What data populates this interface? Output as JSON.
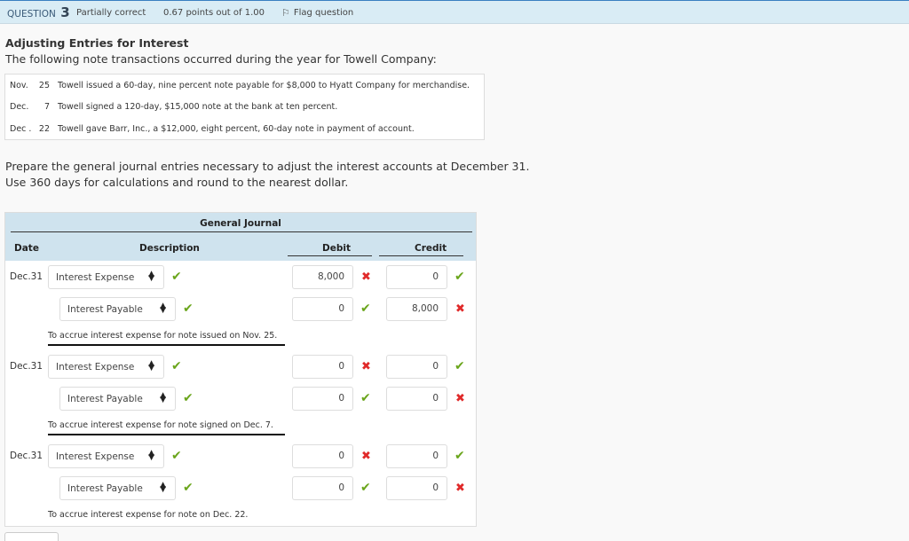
{
  "question_bar": {
    "label": "QUESTION",
    "number": "3",
    "status": "Partially correct",
    "points": "0.67 points out of 1.00",
    "flag_icon": "flag-icon",
    "flag_label": "Flag question"
  },
  "problem": {
    "title": "Adjusting Entries for Interest",
    "intro": "The following note transactions occurred during the year for Towell Company:",
    "notes": [
      {
        "month": "Nov.",
        "day": "25",
        "text": "Towell issued a 60-day, nine percent note payable for $8,000 to Hyatt Company for merchandise."
      },
      {
        "month": "Dec.",
        "day": "7",
        "text": "Towell signed a 120-day, $15,000 note at the bank at ten percent."
      },
      {
        "month": "Dec .",
        "day": "22",
        "text": "Towell gave Barr, Inc., a $12,000, eight percent, 60-day note in payment of account."
      }
    ],
    "prompt_line1": "Prepare the general journal entries necessary to adjust the interest accounts at December 31.",
    "prompt_line2": "Use 360 days for calculations and round to the nearest dollar."
  },
  "journal": {
    "title": "General Journal",
    "columns": {
      "date": "Date",
      "description": "Description",
      "debit": "Debit",
      "credit": "Credit"
    },
    "entries": [
      {
        "date": "Dec.31",
        "lines": [
          {
            "account": "Interest Expense",
            "account_mark": "correct",
            "debit": "8,000",
            "debit_mark": "incorrect",
            "credit": "0",
            "credit_mark": "correct"
          },
          {
            "account": "Interest Payable",
            "account_mark": "correct",
            "debit": "0",
            "debit_mark": "correct",
            "credit": "8,000",
            "credit_mark": "incorrect"
          }
        ],
        "memo": "To accrue interest expense for note issued on Nov. 25."
      },
      {
        "date": "Dec.31",
        "lines": [
          {
            "account": "Interest Expense",
            "account_mark": "correct",
            "debit": "0",
            "debit_mark": "incorrect",
            "credit": "0",
            "credit_mark": "correct"
          },
          {
            "account": "Interest Payable",
            "account_mark": "correct",
            "debit": "0",
            "debit_mark": "correct",
            "credit": "0",
            "credit_mark": "incorrect"
          }
        ],
        "memo": "To accrue interest expense for note signed on Dec. 7."
      },
      {
        "date": "Dec.31",
        "lines": [
          {
            "account": "Interest Expense",
            "account_mark": "correct",
            "debit": "0",
            "debit_mark": "incorrect",
            "credit": "0",
            "credit_mark": "correct"
          },
          {
            "account": "Interest Payable",
            "account_mark": "correct",
            "debit": "0",
            "debit_mark": "correct",
            "credit": "0",
            "credit_mark": "incorrect"
          }
        ],
        "memo": "To accrue interest expense for note on Dec. 22."
      }
    ]
  },
  "marks": {
    "correct": "✔",
    "incorrect": "✖"
  },
  "colors": {
    "accent": "#3a80c1",
    "header_bg": "#d9ecf5",
    "journal_header_bg": "#cfe3ee",
    "correct": "#6aa51b",
    "incorrect": "#e02a2a"
  }
}
